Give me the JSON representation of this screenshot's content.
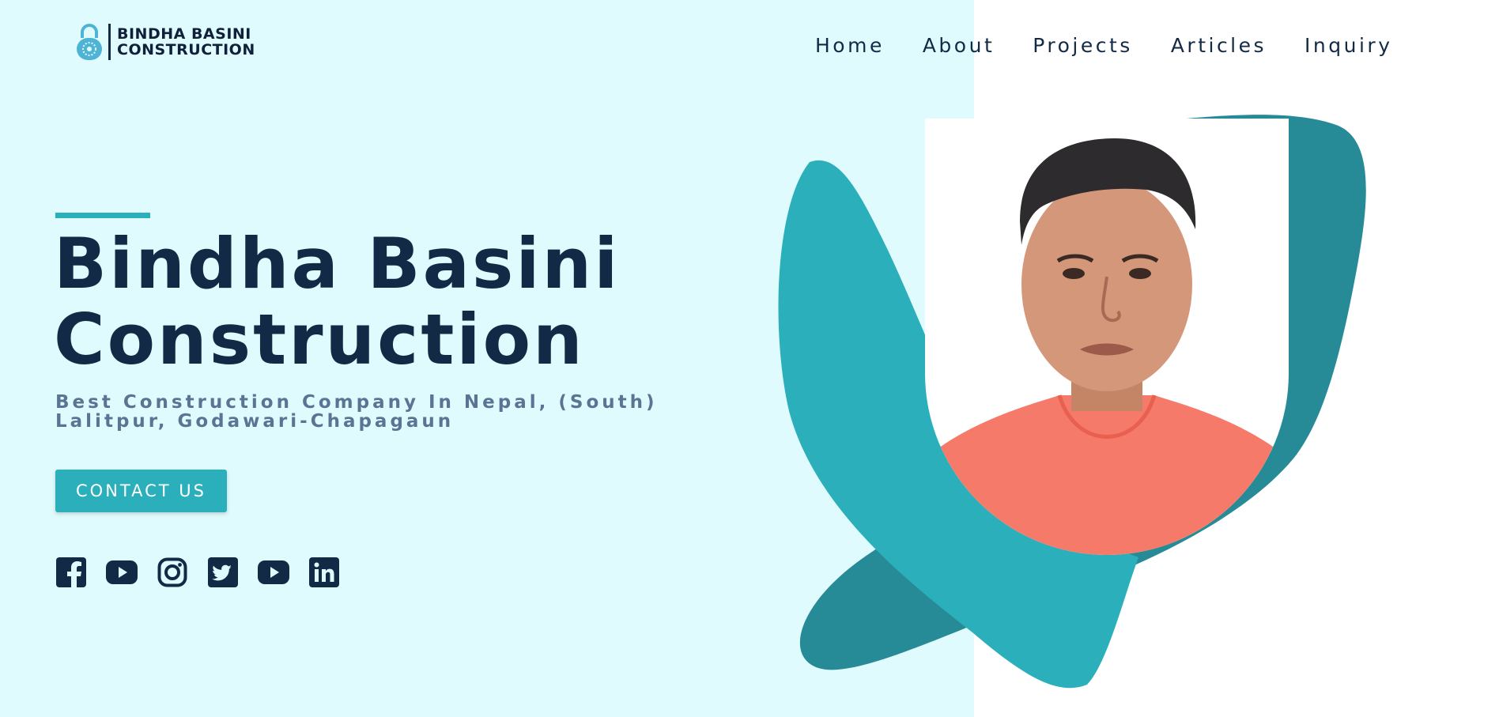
{
  "header": {
    "logo": {
      "line1": "BINDHA BASINI",
      "line2": "CONSTRUCTION",
      "icon": "padlock-icon"
    },
    "nav": [
      {
        "label": "Home"
      },
      {
        "label": "About"
      },
      {
        "label": "Projects"
      },
      {
        "label": "Articles"
      },
      {
        "label": "Inquiry"
      }
    ]
  },
  "hero": {
    "title_line1": "Bindha Basini",
    "title_line2": "Construction",
    "subtitle": "Best Construction Company In Nepal, (South) Lalitpur, Godawari-Chapagaun",
    "cta_label": "CONTACT US"
  },
  "socials": [
    {
      "icon": "facebook-icon"
    },
    {
      "icon": "youtube-icon"
    },
    {
      "icon": "instagram-icon"
    },
    {
      "icon": "twitter-icon"
    },
    {
      "icon": "youtube-icon"
    },
    {
      "icon": "linkedin-icon"
    }
  ],
  "portrait": {
    "icon": "person-photo"
  },
  "colors": {
    "left_background": "#e0fbfd",
    "right_background": "#ffffff",
    "accent": "#2bb0bb",
    "accent_dark": "#268b96",
    "text_dark": "#132a46",
    "subtitle": "#5a7494",
    "shirt": "#f57a6a"
  }
}
